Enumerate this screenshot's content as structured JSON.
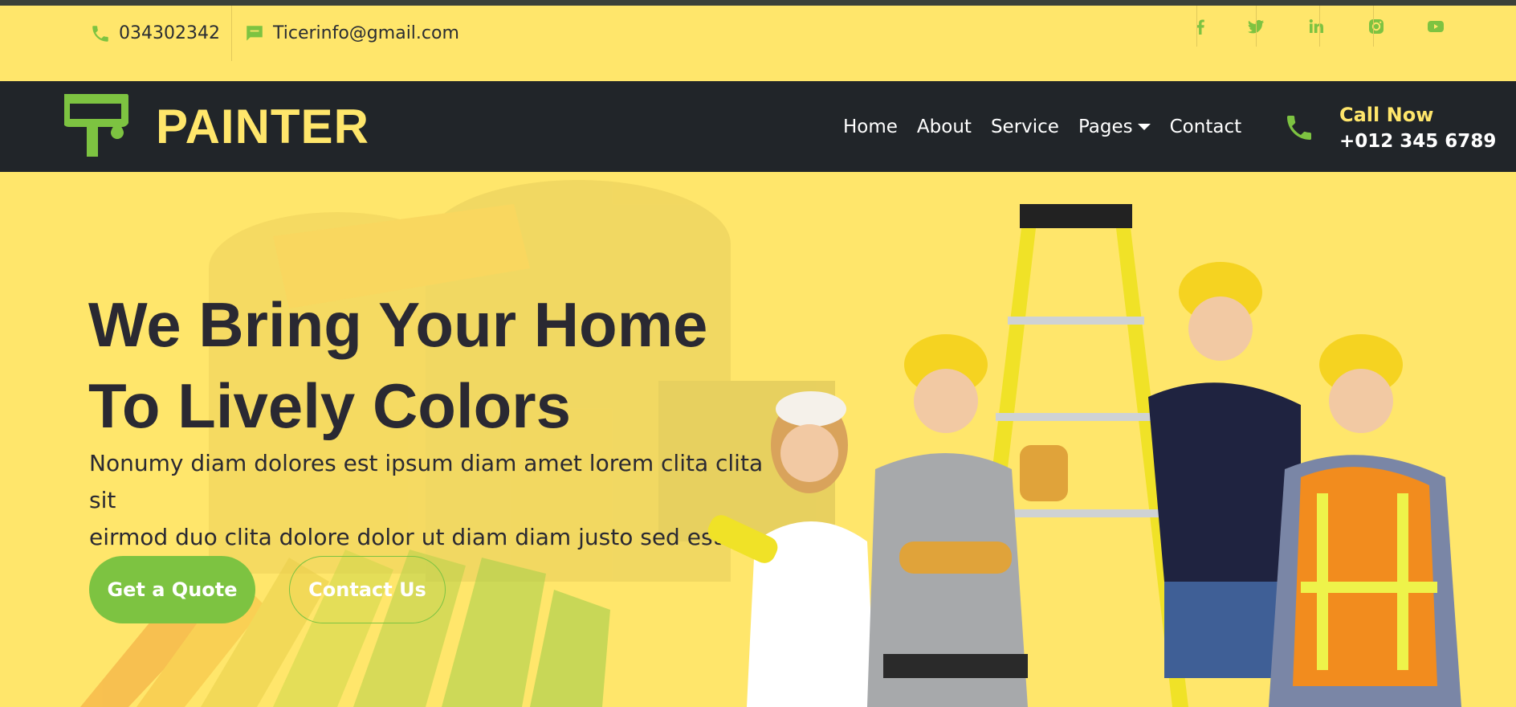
{
  "topbar": {
    "phone": "034302342",
    "email": "Ticerinfo@gmail.com",
    "socials": [
      "facebook-icon",
      "twitter-icon",
      "linkedin-icon",
      "instagram-icon",
      "youtube-icon"
    ]
  },
  "navbar": {
    "brand": "PAINTER",
    "items": [
      "Home",
      "About",
      "Service",
      "Pages",
      "Contact"
    ],
    "call_label": "Call Now",
    "call_number": "+012 345 6789"
  },
  "hero": {
    "title_line1": "We Bring Your Home",
    "title_line2": "To Lively Colors",
    "text_line1": "Nonumy diam dolores est ipsum diam amet lorem clita clita sit",
    "text_line2": "eirmod duo clita dolore dolor ut diam diam justo sed est",
    "button_quote": "Get a Quote",
    "button_contact": "Contact Us"
  },
  "colors": {
    "brand_yellow": "#ffe66b",
    "accent_green": "#7dc341",
    "dark": "#212529",
    "text_dark": "#2a2932"
  }
}
